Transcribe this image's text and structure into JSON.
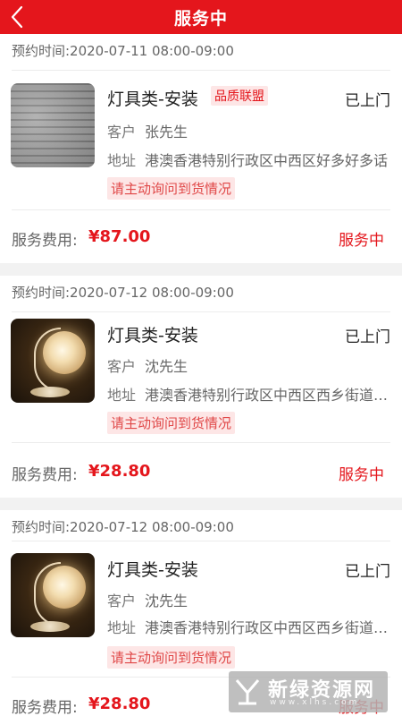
{
  "header": {
    "title": "服务中",
    "back_icon": "chevron-left-icon"
  },
  "orders": [
    {
      "appointment": "预约时间:2020-07-11 08:00-09:00",
      "thumbnail": "document-image",
      "title": "灯具类-安装",
      "tag": "品质联盟",
      "door_status": "已上门",
      "customer_label": "客户",
      "customer_name": "张先生",
      "address_label": "地址",
      "address": "港澳香港特别行政区中西区好多好多话",
      "notice": "请主动询问到货情况",
      "fee_label": "服务费用:",
      "fee": "¥87.00",
      "status": "服务中"
    },
    {
      "appointment": "预约时间:2020-07-12 08:00-09:00",
      "thumbnail": "lamp-image",
      "title": "灯具类-安装",
      "door_status": "已上门",
      "customer_label": "客户",
      "customer_name": "沈先生",
      "address_label": "地址",
      "address": "港澳香港特别行政区中西区西乡街道宝...",
      "notice": "请主动询问到货情况",
      "fee_label": "服务费用:",
      "fee": "¥28.80",
      "status": "服务中"
    },
    {
      "appointment": "预约时间:2020-07-12 08:00-09:00",
      "thumbnail": "lamp-image",
      "title": "灯具类-安装",
      "door_status": "已上门",
      "customer_label": "客户",
      "customer_name": "沈先生",
      "address_label": "地址",
      "address": "港澳香港特别行政区中西区西乡街道宝...",
      "notice": "请主动询问到货情况",
      "fee_label": "服务费用:",
      "fee": "¥28.80",
      "status": "服务中"
    }
  ],
  "watermark": {
    "text": "新绿资源网",
    "sub": "www.xlhs.com"
  },
  "colors": {
    "accent": "#e4161c",
    "tag_bg": "#fde6e6",
    "gap": "#f2f2f2"
  }
}
